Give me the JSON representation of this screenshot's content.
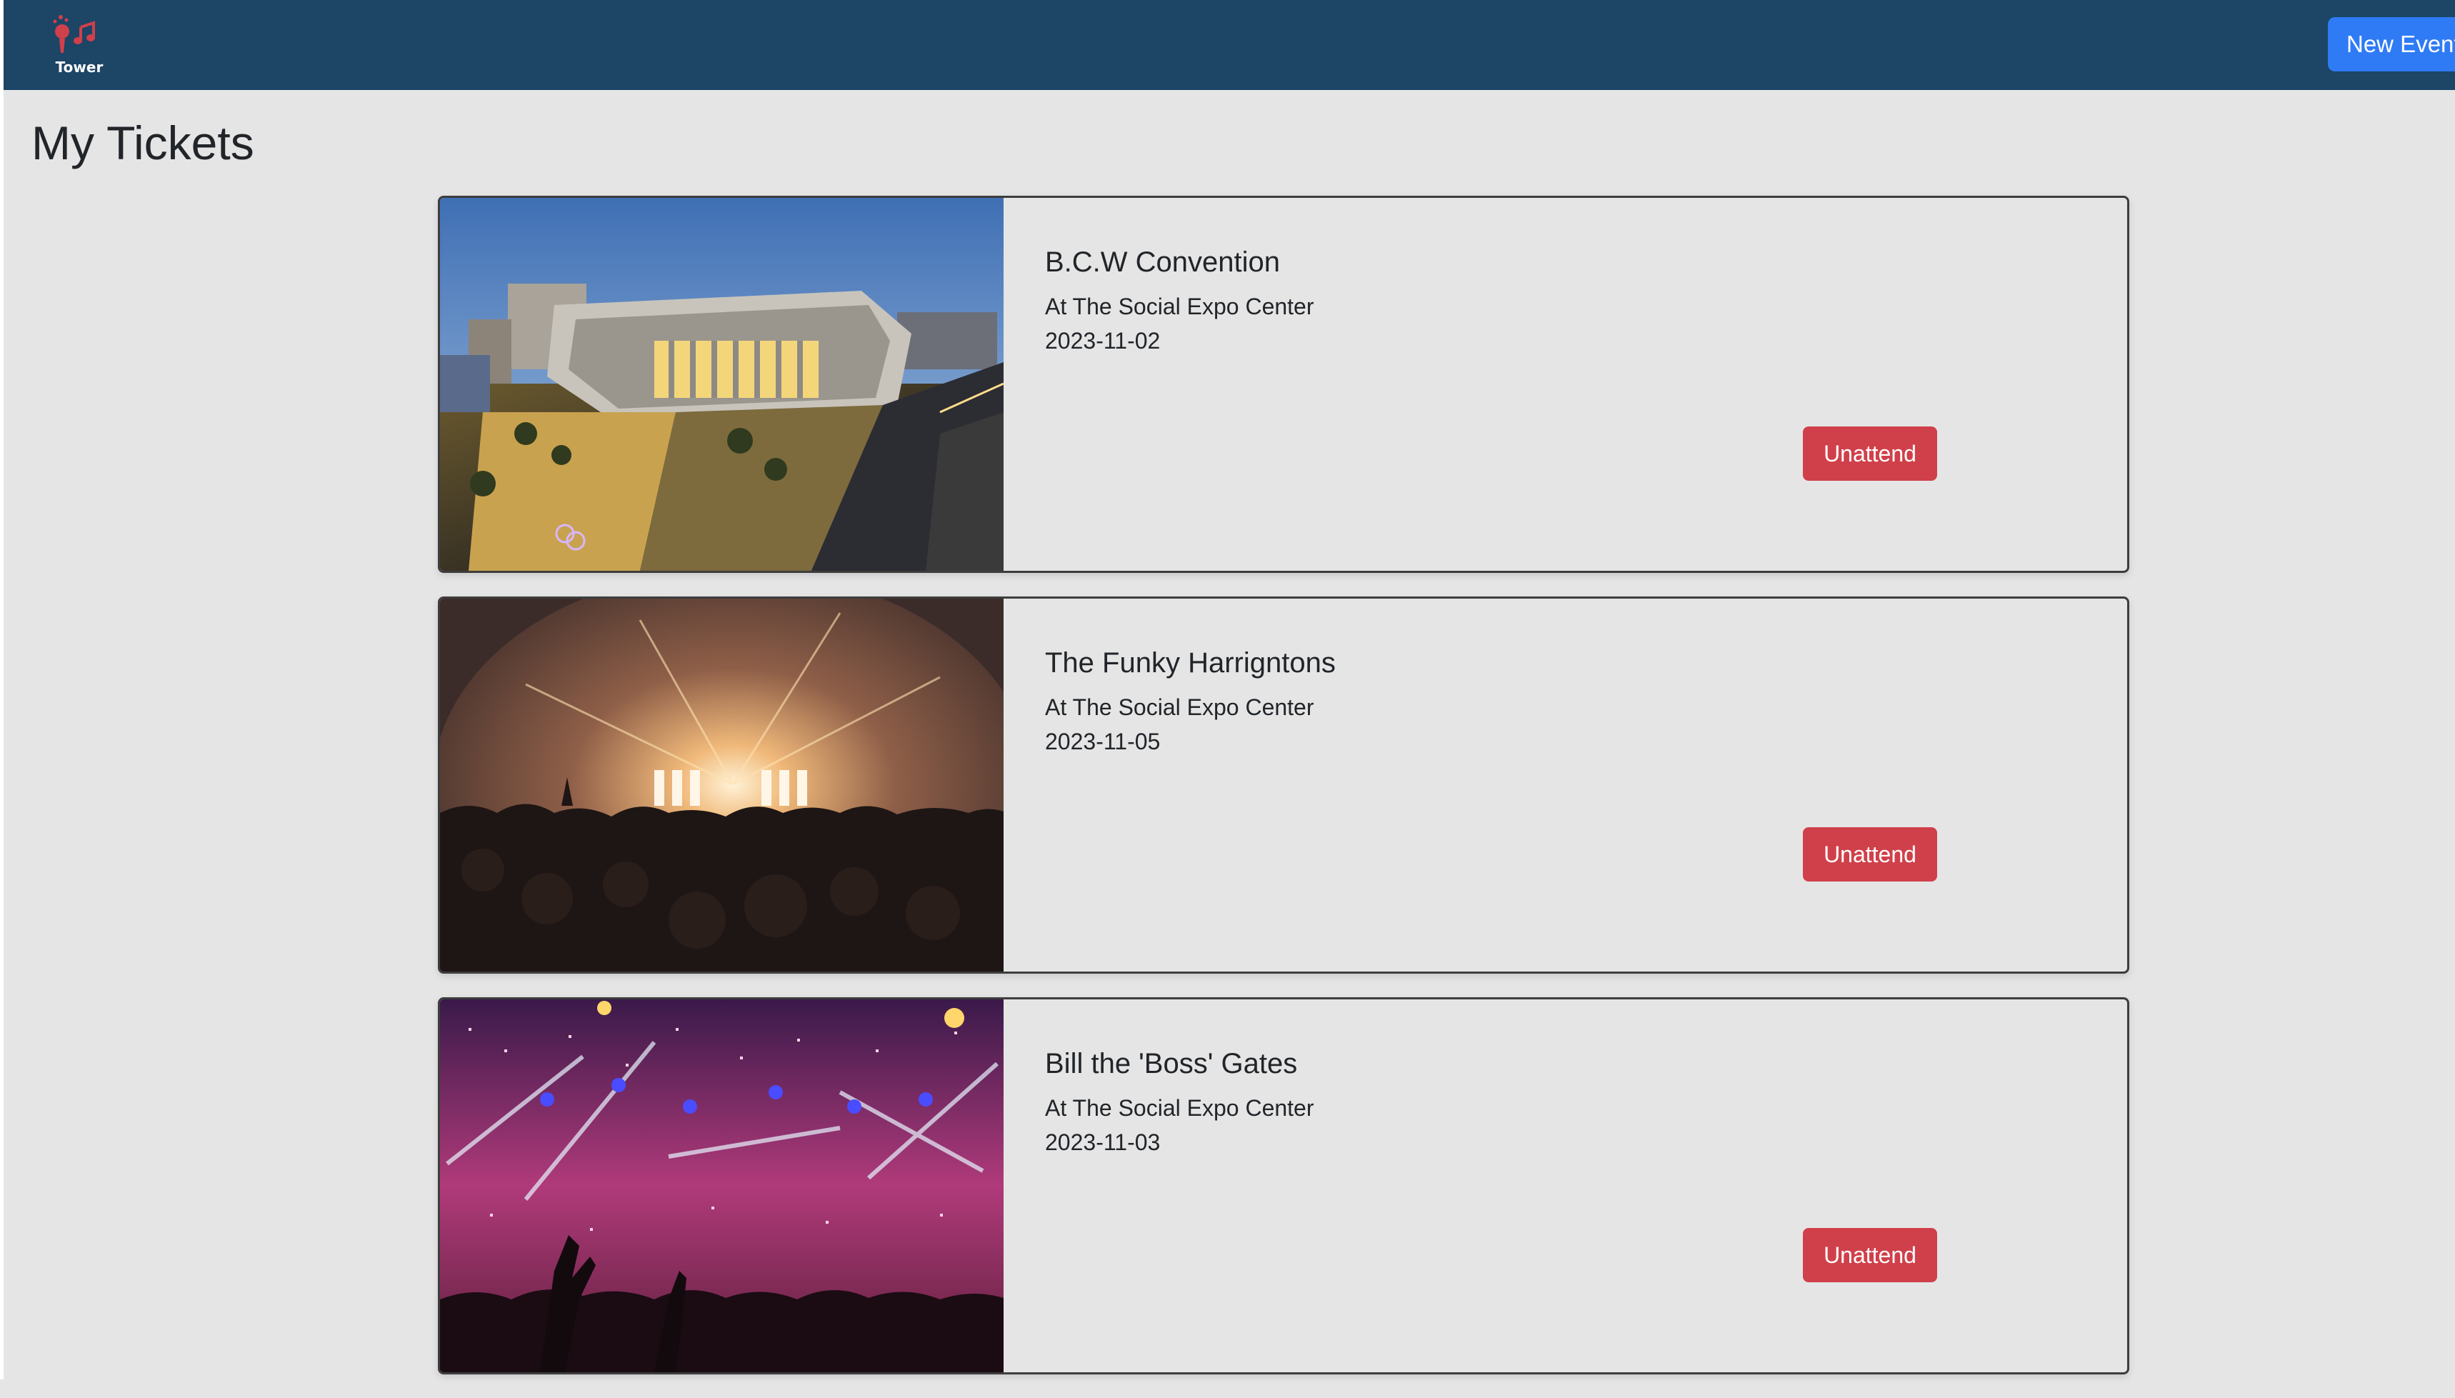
{
  "navbar": {
    "logo_text": "Tower",
    "new_event_label": "New Event"
  },
  "page": {
    "title": "My Tickets"
  },
  "tickets": [
    {
      "name": "B.C.W Convention",
      "location": "At The Social Expo Center",
      "date": "2023-11-02",
      "action_label": "Unattend"
    },
    {
      "name": "The Funky Harrigntons",
      "location": "At The Social Expo Center",
      "date": "2023-11-05",
      "action_label": "Unattend"
    },
    {
      "name": "Bill the 'Boss' Gates",
      "location": "At The Social Expo Center",
      "date": "2023-11-03",
      "action_label": "Unattend"
    }
  ],
  "colors": {
    "navbar": "#1c4566",
    "background": "#e5e5e5",
    "primary_button": "#2f7bf5",
    "danger_button": "#d0404a",
    "logo_accent": "#d0404a"
  },
  "icons": {
    "logo": "microphone-music-note-icon"
  }
}
